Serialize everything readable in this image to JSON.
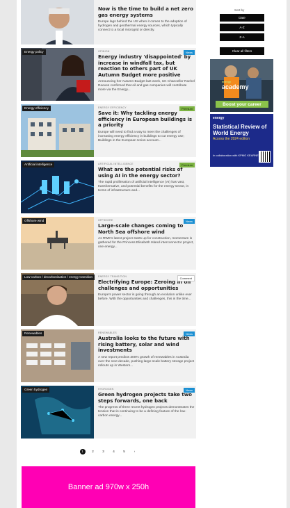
{
  "articles": [
    {
      "tag": "",
      "meta": "",
      "badge": "",
      "badge_type": "",
      "title": "Now is the time to build a net zero gas energy systems",
      "excerpt": "Europe lags behind the US when it comes to the adoption of hydrogen and geothermal energy sources, which typically connect to a local microgrid or directly.",
      "image": "portrait-grey-hair-man"
    },
    {
      "tag": "Energy policy",
      "meta": "OPINION",
      "badge": "News",
      "badge_type": "news",
      "title": "Energy industry 'disappointed' by increase in windfall tax, but reaction to others part of UK Autumn Budget more positive",
      "excerpt": "Announcing her Autumn Budget last week, UK Chancellor Rachel Reeves confirmed that oil and gas companies will contribute more via the Energy...",
      "image": "chancellor-red-box"
    },
    {
      "tag": "Energy efficiency",
      "meta": "ENERGY EFFICIENCY",
      "badge": "Premium",
      "badge_type": "premium",
      "title": "Save it: Why tackling energy efficiency in European buildings is a priority",
      "excerpt": "Europe will need to find a way to meet the challenges of increasing energy efficiency in buildings to cut energy use; Buildings in the European Union account...",
      "image": "residential-buildings"
    },
    {
      "tag": "Artificial intelligence",
      "meta": "ARTIFICIAL INTELLIGENCE",
      "badge": "Premium",
      "badge_type": "premium",
      "title": "What are the potential risks of using AI in the energy sector?",
      "excerpt": "The rapid proliferation of artificial intelligence (AI) has vast, transformative, and potential benefits for the energy sector, in terms of infrastructure and...",
      "image": "digital-energy-network"
    },
    {
      "tag": "Offshore wind",
      "meta": "OFFSHORE",
      "badge": "News",
      "badge_type": "news",
      "title": "Large-scale changes coming to North Sea offshore wind",
      "excerpt": "As RWE's latest project starts up for construction, momentum is gathered for the Princess Elisabeth Island interconnector project, one energy...",
      "image": "offshore-platform-sea"
    },
    {
      "tag": "Low-carbon / decarbonisation / energy transition",
      "meta": "ENERGY TRANSITION",
      "badge": "Comment",
      "badge_type": "comment",
      "title": "Electrifying Europe: Zeroing in on challenges and opportunities",
      "excerpt": "Europe's power sector is going through an evolution unlike ever before. With the opportunities and challenges, this is the time...",
      "image": "man-video-call"
    },
    {
      "tag": "Renewables",
      "meta": "RENEWABLES",
      "badge": "News",
      "badge_type": "news",
      "title": "Australia looks to the future with rising battery, solar and wind investments",
      "excerpt": "A new report predicts 300% growth of renewables in Australia over the next decade, pushing large-scale battery storage project rollouts up in Western...",
      "image": "battery-storage-aerial"
    },
    {
      "tag": "Green hydrogen",
      "meta": "HYDROGEN",
      "badge": "News",
      "badge_type": "news",
      "title": "Green hydrogen projects take two steps forwards, one back",
      "excerpt": "The progress of three recent hydrogen projects demonstrates the tension that is continuing to be a defining feature of the low-carbon energy...",
      "image": "hydrogen-map"
    }
  ],
  "pagination": {
    "pages": [
      "1",
      "2",
      "3",
      "4",
      "5",
      "›"
    ],
    "current": "1"
  },
  "banner": {
    "label": "Banner ad 970w x 250h"
  },
  "sidebar": {
    "sort_label": "Sort by",
    "sort_options": [
      "Date",
      "A-Z",
      "Z-A"
    ],
    "clear_label": "Clear all filters",
    "ad1": {
      "brand": "energy",
      "brand_sub": "academy",
      "cta": "Boost your career"
    },
    "ad2": {
      "brand": "energy",
      "title": "Statistical Review of World Energy",
      "subtitle": "Access the 2024 edition",
      "collab": "In collaboration with KPMG  KEARNEY"
    }
  },
  "colors": {
    "banner": "#ff00b4",
    "news": "#1b8fd2",
    "premium": "#7cb342",
    "cta": "#8bc34a"
  }
}
